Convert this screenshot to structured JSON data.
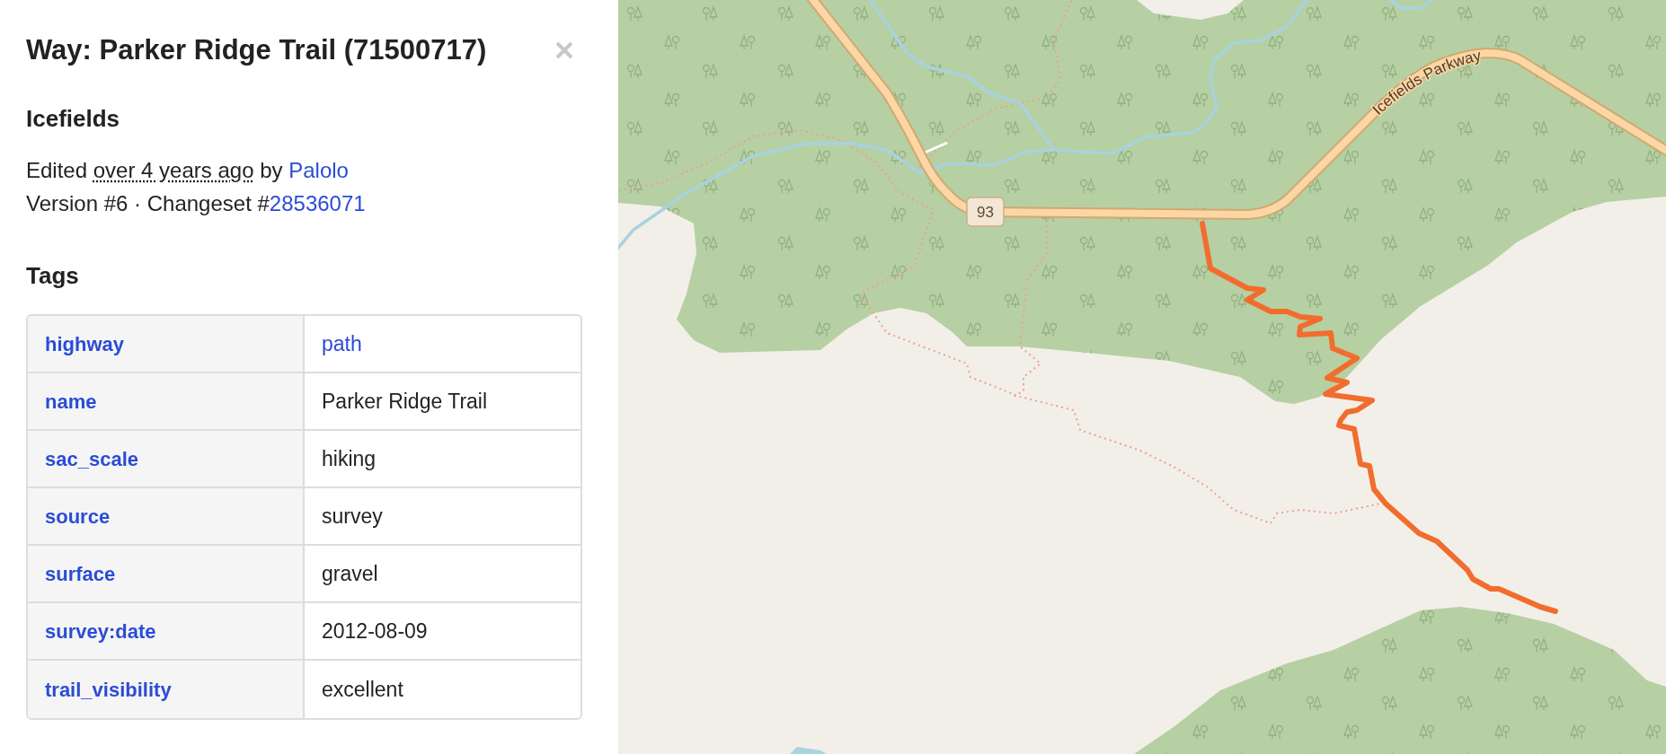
{
  "panel": {
    "title": "Way: Parker Ridge Trail (71500717)",
    "subtitle": "Icefields",
    "edit_info": {
      "prefix": "Edited",
      "time_ago": "over 4 years ago",
      "by": "by",
      "user": "Palolo"
    },
    "version_info": {
      "text": "Version #6 · Changeset #",
      "changeset": "28536071"
    },
    "tags_heading": "Tags",
    "tags": [
      {
        "key": "highway",
        "value": "path",
        "value_is_link": true
      },
      {
        "key": "name",
        "value": "Parker Ridge Trail",
        "value_is_link": false
      },
      {
        "key": "sac_scale",
        "value": "hiking",
        "value_is_link": false
      },
      {
        "key": "source",
        "value": "survey",
        "value_is_link": false
      },
      {
        "key": "surface",
        "value": "gravel",
        "value_is_link": false
      },
      {
        "key": "survey:date",
        "value": "2012-08-09",
        "value_is_link": false
      },
      {
        "key": "trail_visibility",
        "value": "excellent",
        "value_is_link": false
      }
    ]
  },
  "map": {
    "route_shield": "93",
    "road_label": "Icefields Parkway"
  }
}
